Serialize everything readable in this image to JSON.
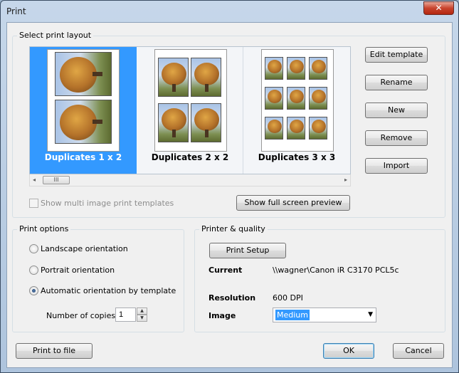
{
  "window": {
    "title": "Print",
    "close_glyph": "✕"
  },
  "layout_group": {
    "label": "Select print layout",
    "items": [
      {
        "label": "Duplicates 1 x 2",
        "selected": true
      },
      {
        "label": "Duplicates 2 x 2",
        "selected": false
      },
      {
        "label": "Duplicates 3 x 3",
        "selected": false
      }
    ],
    "scroll_thumb_glyph": "III",
    "scroll_left_glyph": "◂",
    "scroll_right_glyph": "▸"
  },
  "template_buttons": {
    "edit": "Edit template",
    "rename": "Rename",
    "new": "New",
    "remove": "Remove",
    "import": "Import"
  },
  "multi_image_checkbox": {
    "label": "Show multi image print templates",
    "checked": false,
    "enabled": false
  },
  "preview_button": "Show full screen preview",
  "print_options": {
    "label": "Print options",
    "landscape": "Landscape orientation",
    "portrait": "Portrait orientation",
    "automatic": "Automatic orientation by template",
    "selected": "automatic",
    "copies_label": "Number of copies",
    "copies_value": "1",
    "spin_up": "▲",
    "spin_down": "▼"
  },
  "printer_quality": {
    "label": "Printer & quality",
    "setup_button": "Print Setup",
    "current_label": "Current",
    "current_value": "\\\\wagner\\Canon iR C3170 PCL5c",
    "resolution_label": "Resolution",
    "resolution_value": "600 DPI",
    "image_label": "Image",
    "image_value": "Medium",
    "dropdown_glyph": "▼"
  },
  "footer": {
    "print_to_file": "Print to file",
    "ok": "OK",
    "cancel": "Cancel"
  },
  "colors": {
    "selection": "#3399ff",
    "title_close": "#c8432d"
  }
}
